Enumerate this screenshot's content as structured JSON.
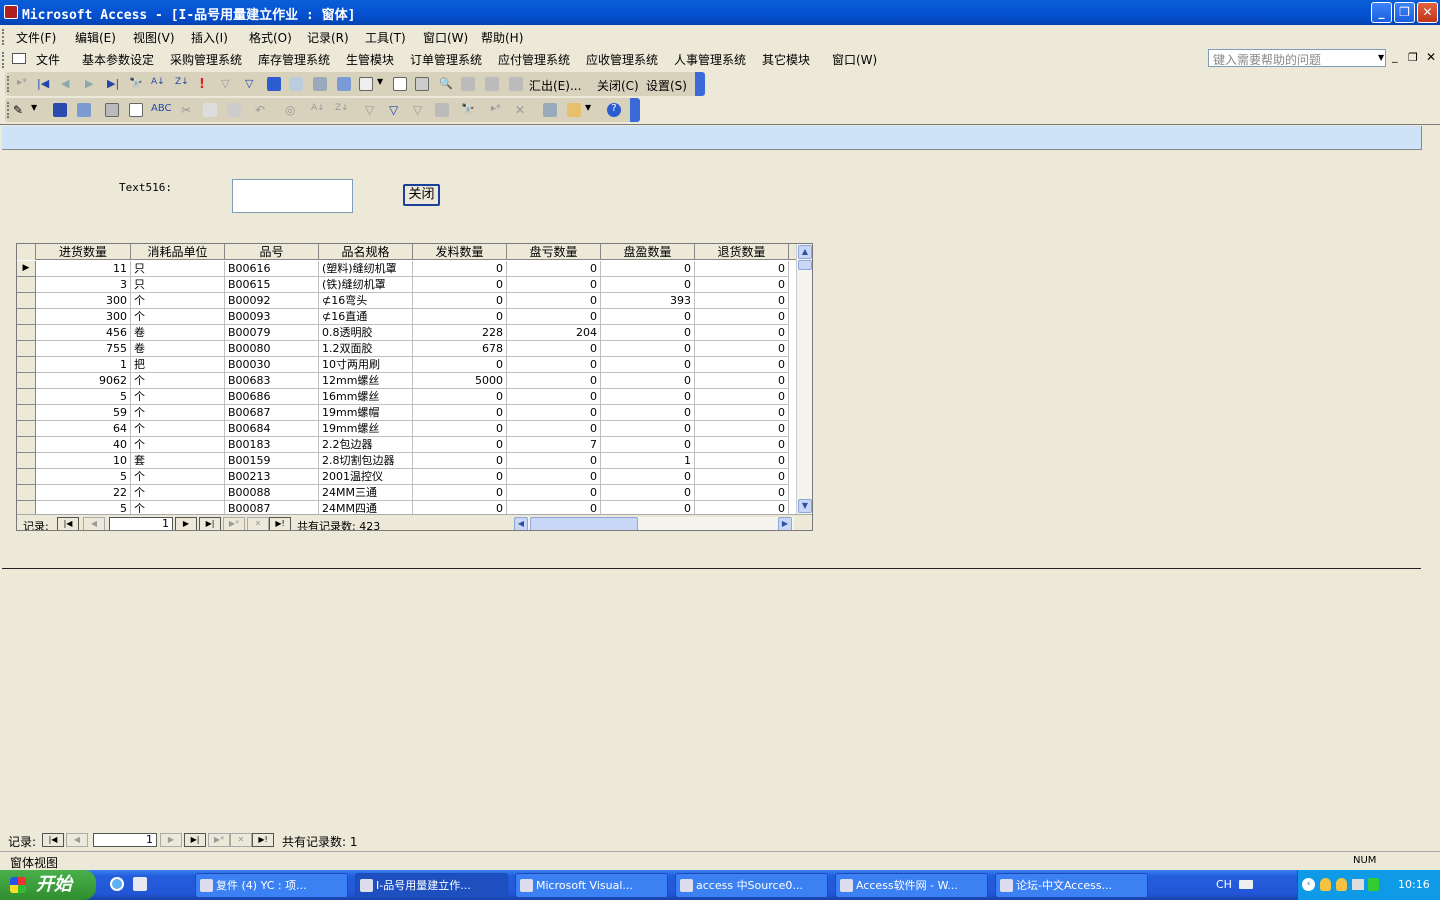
{
  "window": {
    "title": "Microsoft Access - [I-品号用量建立作业 : 窗体]"
  },
  "menu": [
    "文件(F)",
    "编辑(E)",
    "视图(V)",
    "插入(I)",
    "格式(O)",
    "记录(R)",
    "工具(T)",
    "窗口(W)",
    "帮助(H)"
  ],
  "commandbar": [
    "文件",
    "基本参数设定",
    "采购管理系统",
    "库存管理系统",
    "生管模块",
    "订单管理系统",
    "应付管理系统",
    "应收管理系统",
    "人事管理系统",
    "其它模块",
    "窗口(W)"
  ],
  "help_placeholder": "键入需要帮助的问题",
  "toolbar1": {
    "export": "汇出(E)...",
    "close": "关闭(C)",
    "settings": "设置(S)"
  },
  "form": {
    "text_label": "Text516:",
    "close_button": "关闭"
  },
  "grid": {
    "columns": [
      "进货数量",
      "消耗品单位",
      "品号",
      "品名规格",
      "发料数量",
      "盘亏数量",
      "盘盈数量",
      "退货数量"
    ],
    "rows": [
      [
        "11",
        "只",
        "B00616",
        "(塑料)缝纫机罩",
        "0",
        "0",
        "0",
        "0"
      ],
      [
        "3",
        "只",
        "B00615",
        "(铁)缝纫机罩",
        "0",
        "0",
        "0",
        "0"
      ],
      [
        "300",
        "个",
        "B00092",
        "⊄16弯头",
        "0",
        "0",
        "393",
        "0"
      ],
      [
        "300",
        "个",
        "B00093",
        "⊄16直通",
        "0",
        "0",
        "0",
        "0"
      ],
      [
        "456",
        "卷",
        "B00079",
        "0.8透明胶",
        "228",
        "204",
        "0",
        "0"
      ],
      [
        "755",
        "卷",
        "B00080",
        "1.2双面胶",
        "678",
        "0",
        "0",
        "0"
      ],
      [
        "1",
        "把",
        "B00030",
        "10寸两用刷",
        "0",
        "0",
        "0",
        "0"
      ],
      [
        "9062",
        "个",
        "B00683",
        "12mm螺丝",
        "5000",
        "0",
        "0",
        "0"
      ],
      [
        "5",
        "个",
        "B00686",
        "16mm螺丝",
        "0",
        "0",
        "0",
        "0"
      ],
      [
        "59",
        "个",
        "B00687",
        "19mm螺帽",
        "0",
        "0",
        "0",
        "0"
      ],
      [
        "64",
        "个",
        "B00684",
        "19mm螺丝",
        "0",
        "0",
        "0",
        "0"
      ],
      [
        "40",
        "个",
        "B00183",
        "2.2包边器",
        "0",
        "7",
        "0",
        "0"
      ],
      [
        "10",
        "套",
        "B00159",
        "2.8切割包边器",
        "0",
        "0",
        "1",
        "0"
      ],
      [
        "5",
        "个",
        "B00213",
        "2001温控仪",
        "0",
        "0",
        "0",
        "0"
      ],
      [
        "22",
        "个",
        "B00088",
        "24MM三通",
        "0",
        "0",
        "0",
        "0"
      ],
      [
        "5",
        "个",
        "B00087",
        "24MM四通",
        "0",
        "0",
        "0",
        "0"
      ]
    ],
    "nav": {
      "label": "记录:",
      "current": "1",
      "total_label": "共有记录数: 423"
    }
  },
  "formnav": {
    "label": "记录:",
    "current": "1",
    "total_label": "共有记录数: 1"
  },
  "status": {
    "text": "窗体视图",
    "num": "NUM"
  },
  "taskbar": {
    "start": "开始",
    "tasks": [
      "复件 (4) YC : 项...",
      "I-品号用量建立作...",
      "Microsoft Visual...",
      "access 中Source0...",
      "Access软件网 - W...",
      "论坛-中文Access..."
    ],
    "lang": "CH",
    "clock": "10:16"
  }
}
